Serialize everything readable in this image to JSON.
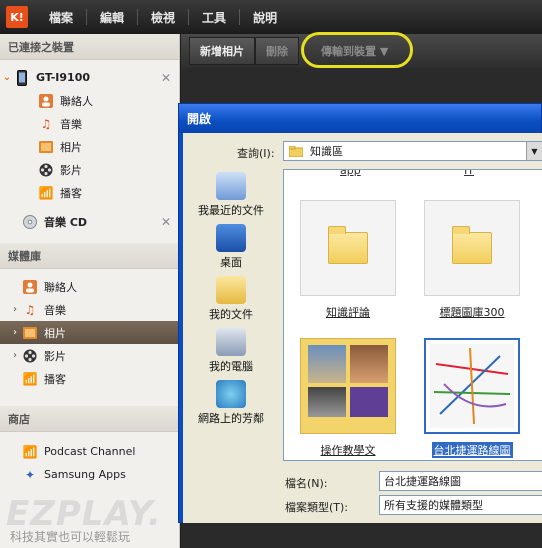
{
  "app": {
    "logo_text": "K!"
  },
  "menu": [
    "檔案",
    "編輯",
    "檢視",
    "工具",
    "說明"
  ],
  "sidebar": {
    "connected_header": "已連接之裝置",
    "device": {
      "name": "GT-I9100"
    },
    "device_items": [
      "聯絡人",
      "音樂",
      "相片",
      "影片",
      "播客"
    ],
    "music_cd": "音樂 CD",
    "library_header": "媒體庫",
    "library_items": [
      "聯絡人",
      "音樂",
      "相片",
      "影片",
      "播客"
    ],
    "store_header": "商店",
    "store_items": [
      "Podcast Channel",
      "Samsung Apps"
    ]
  },
  "toolbar": {
    "new_photo": "新增相片",
    "delete": "刪除",
    "transfer": "傳輸到裝置 ▼"
  },
  "dialog": {
    "title": "開啟",
    "look_in_label": "查詢(I):",
    "look_in_value": "知識區",
    "places": [
      "我最近的文件",
      "桌面",
      "我的文件",
      "我的電腦",
      "網路上的芳鄰"
    ],
    "clipped_labels": [
      "app",
      "IT"
    ],
    "files": [
      {
        "name": "知識評論"
      },
      {
        "name": "標題圖庫300"
      },
      {
        "name": "操作教學文"
      },
      {
        "name": "台北捷運路線圖"
      }
    ],
    "filename_label": "檔名(N):",
    "filename_value": "台北捷運路線圖",
    "filetype_label": "檔案類型(T):",
    "filetype_value": "所有支援的媒體類型"
  },
  "watermark": {
    "main": "EZPLAY.",
    "sub": "科技其實也可以輕鬆玩"
  }
}
